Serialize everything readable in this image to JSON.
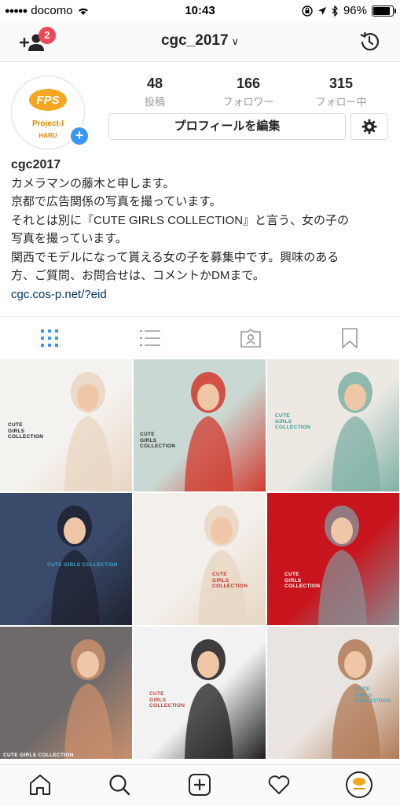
{
  "status_bar": {
    "carrier": "docomo",
    "time": "10:43",
    "battery": "96%",
    "battery_level": 0.96
  },
  "nav": {
    "username": "cgc_2017",
    "notification_count": "2"
  },
  "profile": {
    "avatar_text_top": "FPS",
    "avatar_text_mid": "Project-I",
    "avatar_text_bottom": "HARU",
    "posts_count": "48",
    "posts_label": "投稿",
    "followers_count": "166",
    "followers_label": "フォロワー",
    "following_count": "315",
    "following_label": "フォロー中",
    "edit_label": "プロフィールを編集"
  },
  "bio": {
    "name": "cgc2017",
    "lines": [
      "カメラマンの藤木と申します。",
      "京都で広告関係の写真を撮っています。",
      "それとは別に『CUTE GIRLS COLLECTION』と言う、女の子の",
      "写真を撮っています。",
      "関西でモデルになって貰える女の子を募集中です。興味のある",
      "方、ご質問、お問合せは、コメントかDMまで。"
    ],
    "link": "cgc.cos-p.net/?eid"
  },
  "tabs": [
    "grid-icon",
    "list-icon",
    "tagged-icon",
    "bookmark-icon"
  ],
  "posts": [
    {
      "caption": "CUTE\nGIRLS\nCOLLECTION",
      "bg": "#f4f2ef",
      "accent": "#e9d5c2"
    },
    {
      "caption": "CUTE\nGIRLS\nCOLLECTION",
      "bg": "#c9d8d2",
      "accent": "#d23a2e"
    },
    {
      "caption": "CUTE\nGIRLS\nCOLLECTION",
      "bg": "#ece9e3",
      "accent": "#7fb0a5"
    },
    {
      "caption": "CUTE GIRLS COLLECTION",
      "bg": "#3a4a6b",
      "accent": "#1f2230"
    },
    {
      "caption": "CUTE\nGIRLS\nCOLLECTION",
      "bg": "#f3efea",
      "accent": "#e7d6c1"
    },
    {
      "caption": "CUTE\nGIRLS\nCOLLECTION",
      "bg": "#c8141c",
      "accent": "#8a8c92"
    },
    {
      "caption": "CUTE GIRLS COLLECTION",
      "bg": "#6e6a6a",
      "accent": "#c98f6c"
    },
    {
      "caption": "CUTE\nGIRLS\nCOLLECTION",
      "bg": "#f2f2f2",
      "accent": "#1e1c1c"
    },
    {
      "caption": "CUTE\nGIRLS\nCOLLECTION",
      "bg": "#e9e4df",
      "accent": "#b07a55"
    }
  ],
  "tabbar": [
    "home-icon",
    "search-icon",
    "add-post-icon",
    "activity-icon",
    "profile-tab-icon"
  ]
}
